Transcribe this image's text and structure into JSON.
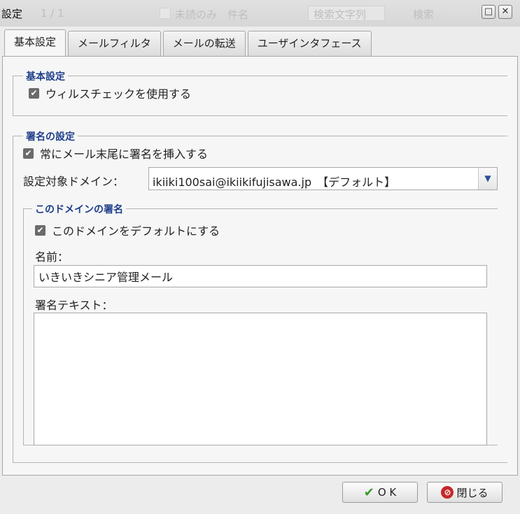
{
  "dialog": {
    "title": "設定",
    "maximize_icon": "maximize-icon",
    "close_icon": "close-icon"
  },
  "background_toolbar": {
    "page_count": "1 / 1",
    "unread_only": "未読のみ",
    "subject": "件名",
    "search_placeholder": "検索文字列",
    "search_button": "検索"
  },
  "tabs": [
    {
      "label": "基本設定",
      "active": true
    },
    {
      "label": "メールフィルタ",
      "active": false
    },
    {
      "label": "メールの転送",
      "active": false
    },
    {
      "label": "ユーザインタフェース",
      "active": false
    }
  ],
  "basic_section": {
    "legend": "基本設定",
    "virus_check_label": "ウィルスチェックを使用する",
    "virus_check_checked": true
  },
  "signature_section": {
    "legend": "署名の設定",
    "always_insert_label": "常にメール末尾に署名を挿入する",
    "always_insert_checked": true,
    "domain_label": "設定対象ドメイン：",
    "domain_value": "ikiiki100sai@ikiikifujisawa.jp　【デフォルト】",
    "domain_group": {
      "legend": "このドメインの署名",
      "default_label": "このドメインをデフォルトにする",
      "default_checked": true,
      "name_label": "名前：",
      "name_value": "いきいきシニア管理メール",
      "signature_label": "署名テキスト：",
      "signature_value": ""
    }
  },
  "footer": {
    "ok_label": "O K",
    "close_label": "閉じる"
  },
  "colors": {
    "legend": "#1e3f8a",
    "ok_icon": "#3c9a2d",
    "close_icon": "#c62828"
  }
}
